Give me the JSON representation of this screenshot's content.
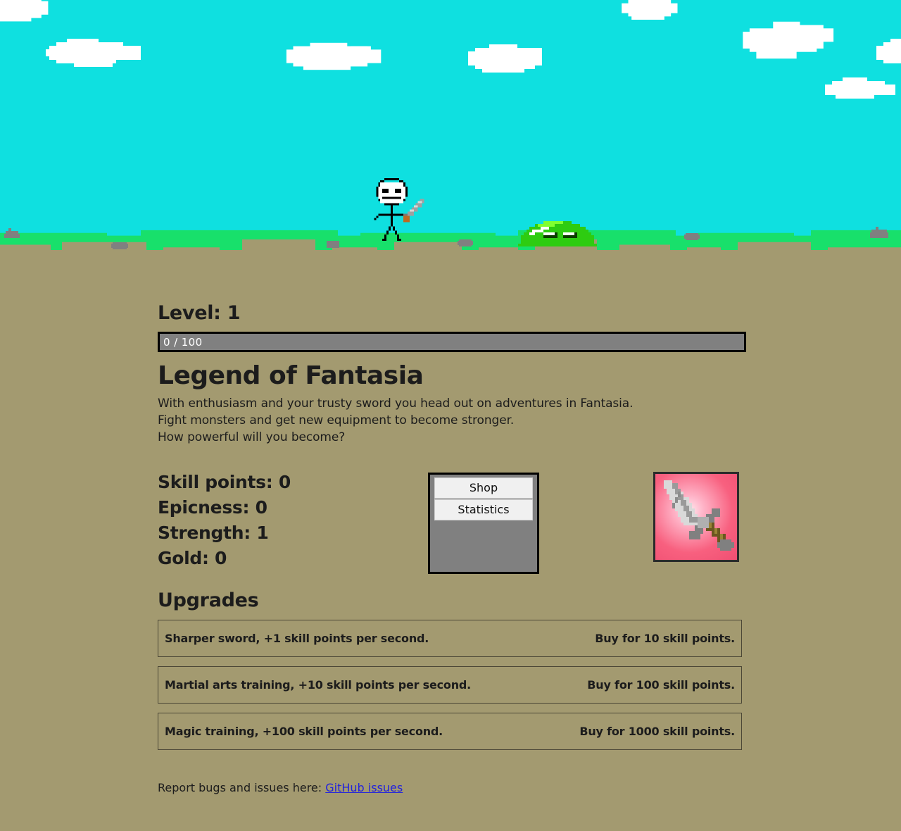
{
  "scene": {
    "sky_color": "#0fe0e0",
    "grass_color": "#18e06b",
    "dirt_color": "#a39a70",
    "cloud_color": "#ffffff",
    "rock_color": "#808080",
    "hero_name": "stick-figure-hero",
    "monster_name": "green-slime"
  },
  "level": {
    "label": "Level: 1",
    "xp_text": "0 / 100",
    "xp_percent": 0
  },
  "title": "Legend of Fantasia",
  "description": [
    "With enthusiasm and your trusty sword you head out on adventures in Fantasia.",
    "Fight monsters and get new equipment to become stronger.",
    "How powerful will you become?"
  ],
  "stats": [
    {
      "label": "Skill points: 0"
    },
    {
      "label": "Epicness: 0"
    },
    {
      "label": "Strength: 1"
    },
    {
      "label": "Gold: 0"
    }
  ],
  "menu": {
    "buttons": [
      {
        "label": "Shop"
      },
      {
        "label": "Statistics"
      }
    ]
  },
  "equipment": {
    "icon_name": "sword-icon",
    "background": "#f8607f"
  },
  "upgrades": {
    "heading": "Upgrades",
    "items": [
      {
        "name": "Sharper sword, +1 skill points per second.",
        "price": "Buy for 10 skill points."
      },
      {
        "name": "Martial arts training, +10 skill points per second.",
        "price": "Buy for 100 skill points."
      },
      {
        "name": "Magic training, +100 skill points per second.",
        "price": "Buy for 1000 skill points."
      }
    ]
  },
  "footer": {
    "text": "Report bugs and issues here:",
    "link_label": "GitHub issues"
  }
}
